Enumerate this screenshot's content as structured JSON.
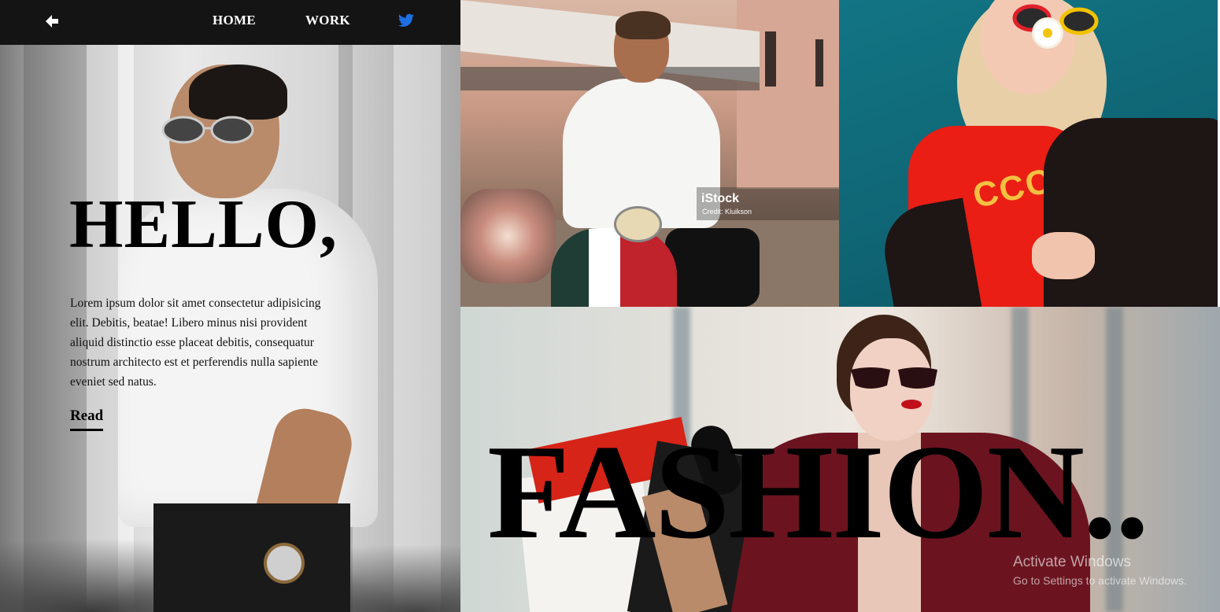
{
  "nav": {
    "home": "HOME",
    "work": "WORK",
    "back_icon": "arrow-left-icon",
    "twitter_icon": "twitter-icon",
    "twitter_color": "#1d6fe3",
    "background": "#141414"
  },
  "hero": {
    "heading": "HELLO,",
    "intro": "Lorem ipsum dolor sit amet consectetur adipisicing elit. Debitis, beatae! Libero minus nisi provident aliquid distinctio esse placeat debitis, consequatur nostrum architecto est et perferendis nulla sapiente eveniet sed natus.",
    "read_link": "Read"
  },
  "gallery": {
    "watermark_brand": "iStock",
    "watermark_credit": "Credit: Kluikson",
    "shirt_print": "CCC",
    "fashion_text": "FASHION.."
  },
  "os_overlay": {
    "title": "Activate Windows",
    "subtitle": "Go to Settings to activate Windows."
  }
}
